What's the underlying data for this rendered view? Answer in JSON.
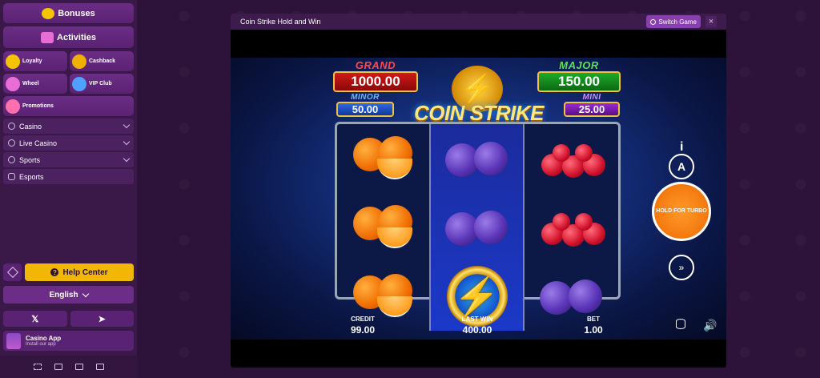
{
  "sidebar": {
    "bonuses": "Bonuses",
    "activities": "Activities",
    "tiles": [
      {
        "label": "Loyalty",
        "icon": "duck-icon",
        "color": "#f5c400"
      },
      {
        "label": "Cashback",
        "icon": "money-bag-icon",
        "color": "#f0b000"
      },
      {
        "label": "Wheel",
        "icon": "wheel-icon",
        "color": "#e96dd6"
      },
      {
        "label": "VIP Club",
        "icon": "vip-icon",
        "color": "#4fa0ff"
      }
    ],
    "promotions": {
      "label": "Promotions",
      "icon": "promotions-icon",
      "color": "#ff6fae"
    },
    "nav": [
      {
        "label": "Casino",
        "icon": "casino-icon"
      },
      {
        "label": "Live Casino",
        "icon": "live-casino-icon"
      },
      {
        "label": "Sports",
        "icon": "sports-icon"
      },
      {
        "label": "Esports",
        "icon": "gamepad-icon"
      }
    ],
    "help_center": "Help Center",
    "language": "English",
    "social_x": "𝕏",
    "social_telegram": "➤",
    "app_title": "Casino App",
    "app_subtitle": "Install our app"
  },
  "game_window": {
    "title": "Coin Strike Hold and Win",
    "switch_game": "Switch Game",
    "close": "×"
  },
  "game": {
    "logo": "COIN STRIKE",
    "jackpots": {
      "grand_label": "GRAND",
      "grand_value": "1000.00",
      "major_label": "MAJOR",
      "major_value": "150.00",
      "minor_label": "MINOR",
      "minor_value": "50.00",
      "mini_label": "MINI",
      "mini_value": "25.00"
    },
    "reels": [
      [
        "orange",
        "orange",
        "orange"
      ],
      [
        "plum",
        "plum",
        "coin"
      ],
      [
        "cherry",
        "cherry",
        "plum"
      ]
    ],
    "info": "i",
    "auto": "A",
    "spin_label": "HOLD FOR TURBO",
    "turbo": "»",
    "credit_label": "CREDIT",
    "credit_value": "99.00",
    "last_win_label": "LAST WIN",
    "last_win_value": "400.00",
    "bet_label": "BET",
    "bet_value": "1.00"
  }
}
